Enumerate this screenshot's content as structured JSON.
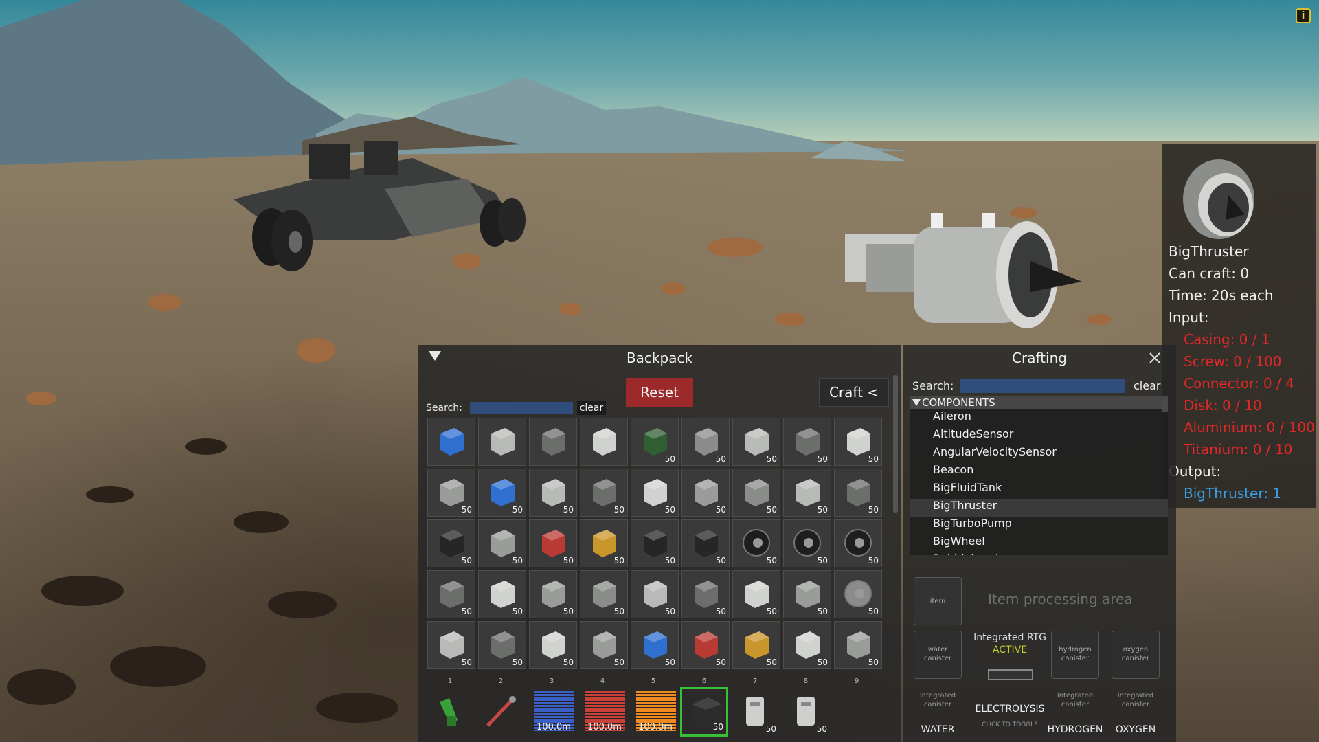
{
  "hud": {
    "info_icon": "info-icon"
  },
  "craft_info": {
    "preview_icon": "big-thruster-icon",
    "name": "BigThruster",
    "can_craft": "Can craft: 0",
    "time": "Time: 20s each",
    "input_label": "Input:",
    "inputs": [
      "Casing: 0 / 1",
      "Screw: 0 / 100",
      "Connector: 0 / 4",
      "Disk: 0 / 10",
      "Aluminium: 0 / 100",
      "Titanium: 0 / 10"
    ],
    "output_label": "Output:",
    "output": "BigThruster: 1",
    "colors": {
      "missing": "#e02828",
      "output": "#3aa0e8"
    }
  },
  "backpack": {
    "title": "Backpack",
    "reset_label": "Reset",
    "craft_label": "Craft <",
    "search_label": "Search:",
    "search_value": "",
    "clear_label": "clear",
    "slots": [
      {
        "icon": "blue-drill-icon",
        "count": ""
      },
      {
        "icon": "paint-roller-icon",
        "count": ""
      },
      {
        "icon": "tag-label-icon",
        "count": ""
      },
      {
        "icon": "control-panel-icon",
        "count": ""
      },
      {
        "icon": "green-screen-icon",
        "count": "50"
      },
      {
        "icon": "monitor-icon",
        "count": "50"
      },
      {
        "icon": "laptop-icon",
        "count": "50"
      },
      {
        "icon": "cabinet-icon",
        "count": "50"
      },
      {
        "icon": "sink-icon",
        "count": "50"
      },
      {
        "icon": "server-block-icon",
        "count": "50"
      },
      {
        "icon": "blue-tower-icon",
        "count": "50"
      },
      {
        "icon": "solar-panel-icon",
        "count": "50"
      },
      {
        "icon": "antenna-icon",
        "count": "50"
      },
      {
        "icon": "grey-block-icon",
        "count": "50"
      },
      {
        "icon": "oven-block-icon",
        "count": "50"
      },
      {
        "icon": "switch-block-icon",
        "count": "50"
      },
      {
        "icon": "teal-block-icon",
        "count": "50"
      },
      {
        "icon": "display-block-icon",
        "count": "50"
      },
      {
        "icon": "seat-icon",
        "count": "50"
      },
      {
        "icon": "robot-arm-icon",
        "count": "50"
      },
      {
        "icon": "red-dot-box-icon",
        "count": "50"
      },
      {
        "icon": "yellow-dot-box-icon",
        "count": "50"
      },
      {
        "icon": "black-plate-icon",
        "count": "50"
      },
      {
        "icon": "battery-icon",
        "count": "50"
      },
      {
        "icon": "wheel-icon",
        "count": "50"
      },
      {
        "icon": "wheel-hub-icon",
        "count": "50"
      },
      {
        "icon": "small-wheel-icon",
        "count": "50"
      },
      {
        "icon": "propeller-icon",
        "count": "50"
      },
      {
        "icon": "dice-block-icon",
        "count": "50"
      },
      {
        "icon": "cylinder-icon",
        "count": "50"
      },
      {
        "icon": "thruster-icon",
        "count": "50"
      },
      {
        "icon": "tank-icon",
        "count": "50"
      },
      {
        "icon": "connector-icon",
        "count": "50"
      },
      {
        "icon": "capsule-icon",
        "count": "50"
      },
      {
        "icon": "long-capsule-icon",
        "count": "50"
      },
      {
        "icon": "sphere-icon",
        "count": "50"
      },
      {
        "icon": "socket-block-icon",
        "count": "50"
      },
      {
        "icon": "pipe-bend-icon",
        "count": "50"
      },
      {
        "icon": "canister-icon",
        "count": "50"
      },
      {
        "icon": "rail-icon",
        "count": "50"
      },
      {
        "icon": "blue-light-icon",
        "count": "50"
      },
      {
        "icon": "red-light-icon",
        "count": "50"
      },
      {
        "icon": "yellow-light-icon",
        "count": "50"
      },
      {
        "icon": "ramp-icon",
        "count": "50"
      },
      {
        "icon": "wedge-icon",
        "count": "50"
      }
    ]
  },
  "hotbar": {
    "numbers": [
      "1",
      "2",
      "3",
      "4",
      "5",
      "6",
      "7",
      "8",
      "9"
    ],
    "slots": [
      {
        "icon": "green-welder-icon",
        "label": "",
        "type": "icon"
      },
      {
        "icon": "red-wrench-icon",
        "label": "",
        "type": "icon"
      },
      {
        "icon": "blue-meter-icon",
        "label": "100.0m",
        "type": "meter",
        "color": "#3a5fc8"
      },
      {
        "icon": "red-meter-icon",
        "label": "100.0m",
        "type": "meter",
        "color": "#c84038"
      },
      {
        "icon": "orange-meter-icon",
        "label": "100.0m",
        "type": "meter",
        "color": "#f08a20"
      },
      {
        "icon": "dark-block-icon",
        "label": "50",
        "type": "count",
        "selected": true
      },
      {
        "icon": "white-box-icon",
        "label": "50",
        "type": "count"
      },
      {
        "icon": "white-canister-icon",
        "label": "50",
        "type": "count"
      },
      {
        "icon": "",
        "label": "",
        "type": "empty"
      }
    ]
  },
  "crafting": {
    "title": "Crafting",
    "search_label": "Search:",
    "search_value": "",
    "clear_label": "clear",
    "category": "COMPONENTS",
    "items": [
      "Aileron",
      "AltitudeSensor",
      "AngularVelocitySensor",
      "Beacon",
      "BigFluidTank",
      "BigThruster",
      "BigTurboPump",
      "BigWheel",
      "Bobblehead"
    ],
    "selected_item": "BigThruster",
    "item_box_label": "item",
    "processing_text": "Item processing area",
    "water_canister": "water canister",
    "hydrogen_canister": "hydrogen canister",
    "oxygen_canister": "oxygen canister",
    "rtg_title": "Integrated RTG",
    "rtg_status": "ACTIVE",
    "integrated_canister": "integrated canister",
    "electrolysis": "ELECTROLYSIS",
    "click_to_toggle": "CLICK TO TOGGLE",
    "water": "WATER",
    "hydrogen": "HYDROGEN",
    "oxygen": "OXYGEN"
  }
}
